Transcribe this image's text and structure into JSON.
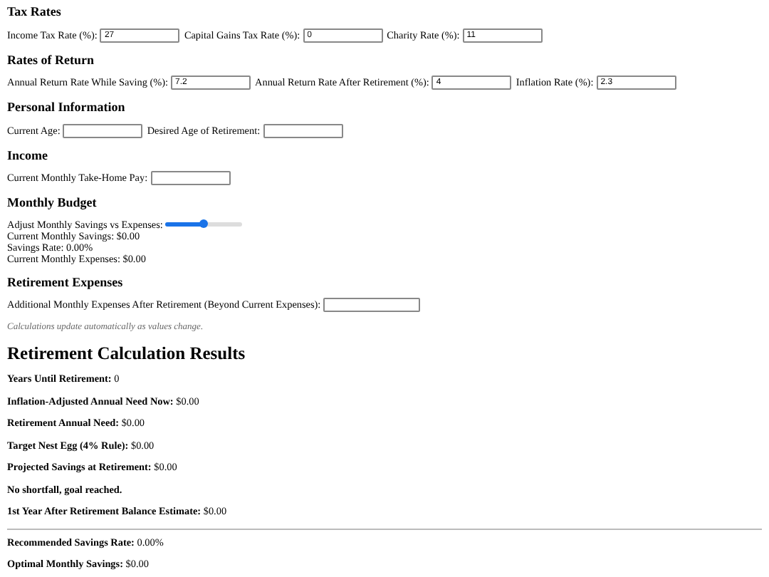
{
  "sections": [
    {
      "title": "Tax Rates",
      "fields": [
        {
          "label": "Income Tax Rate (%):",
          "value": "27"
        },
        {
          "label": "Capital Gains Tax Rate (%):",
          "value": "0"
        },
        {
          "label": "Charity Rate (%):",
          "value": "11"
        }
      ]
    },
    {
      "title": "Rates of Return",
      "fields": [
        {
          "label": "Annual Return Rate While Saving (%):",
          "value": "7.2"
        },
        {
          "label": "Annual Return Rate After Retirement (%):",
          "value": "4"
        },
        {
          "label": "Inflation Rate (%):",
          "value": "2.3"
        }
      ]
    },
    {
      "title": "Personal Information",
      "fields": [
        {
          "label": "Current Age:"
        },
        {
          "label": "Desired Age of Retirement:"
        }
      ]
    },
    {
      "title": "Income",
      "fields": [
        {
          "label": "Current Monthly Take-Home Pay:"
        }
      ]
    }
  ],
  "budget": {
    "title": "Monthly Budget",
    "slider_label": "Adjust Monthly Savings vs Expenses:",
    "level": 0.5,
    "lines": [
      "Current Monthly Savings: $0.00",
      "Savings Rate: 0.00%",
      "Current Monthly Expenses: $0.00"
    ]
  },
  "retirement_expenses": {
    "title": "Retirement Expenses",
    "field": {
      "label": "Additional Monthly Expenses After Retirement (Beyond Current Expenses):"
    },
    "note": "Calculations update automatically as values change."
  },
  "results": {
    "title": "Retirement Calculation Results",
    "items": [
      {
        "kind": "metric",
        "label": "Years Until Retirement:",
        "value": "0"
      },
      {
        "kind": "metric",
        "label": "Inflation-Adjusted Annual Need Now:",
        "value": "$0.00"
      },
      {
        "kind": "metric",
        "label": "Retirement Annual Need:",
        "value": "$0.00"
      },
      {
        "kind": "metric",
        "label": "Target Nest Egg (4% Rule):",
        "value": "$0.00"
      },
      {
        "kind": "metric",
        "label": "Projected Savings at Retirement:",
        "value": "$0.00"
      },
      {
        "kind": "message",
        "label": "No shortfall, goal reached."
      },
      {
        "kind": "metric",
        "label": "1st Year After Retirement Balance Estimate:",
        "value": "$0.00"
      },
      {
        "kind": "divider"
      },
      {
        "kind": "metric",
        "label": "Recommended Savings Rate:",
        "value": "0.00%"
      },
      {
        "kind": "metric",
        "label": "Optimal Monthly Savings:",
        "value": "$0.00"
      }
    ]
  }
}
